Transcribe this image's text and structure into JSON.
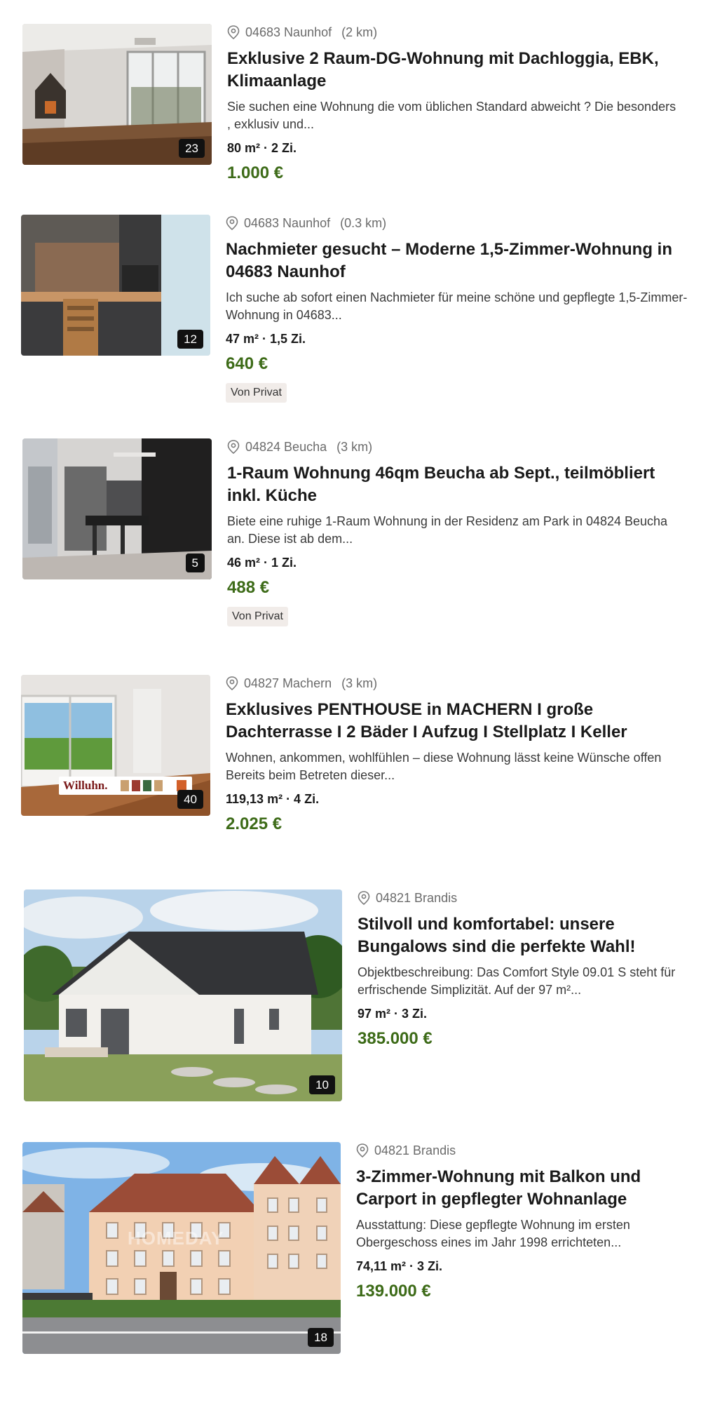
{
  "listings": [
    {
      "location": "04683 Naunhof",
      "distance": "(2 km)",
      "title": "Exklusive 2 Raum-DG-Wohnung mit Dachloggia, EBK, Klimaanlage",
      "description": "Sie suchen eine Wohnung die vom üblichen Standard abweicht ? Die besonders , exklusiv und...",
      "specs": "80 m² · 2 Zi.",
      "price": "1.000 €",
      "photo_count": "23",
      "tag": "",
      "image": "loft-interior-photo"
    },
    {
      "location": "04683 Naunhof",
      "distance": "(0.3 km)",
      "title": "Nachmieter gesucht – Moderne 1,5-Zimmer-Wohnung in 04683 Naunhof",
      "description": "Ich suche ab sofort einen Nachmieter für meine schöne und gepflegte 1,5-Zimmer-Wohnung in 04683...",
      "specs": "47 m² · 1,5 Zi.",
      "price": "640 €",
      "photo_count": "12",
      "tag": "Von Privat",
      "image": "kitchen-photo"
    },
    {
      "location": "04824 Beucha",
      "distance": "(3 km)",
      "title": "1-Raum Wohnung 46qm Beucha ab Sept., teilmöbliert inkl. Küche",
      "description": "Biete eine ruhige 1-Raum Wohnung in der Residenz am Park in 04824 Beucha an. Diese ist ab dem...",
      "specs": "46 m² · 1 Zi.",
      "price": "488 €",
      "photo_count": "5",
      "tag": "Von Privat",
      "image": "apartment-kitchen-photo"
    },
    {
      "location": "04827 Machern",
      "distance": "(3 km)",
      "title": "Exklusives PENTHOUSE in MACHERN I große Dachterrasse I 2 Bäder I Aufzug I Stellplatz I Keller",
      "description": "Wohnen, ankommen, wohlfühlen – diese Wohnung lässt keine Wünsche offen Bereits beim Betreten dieser...",
      "specs": "119,13 m² · 4 Zi.",
      "price": "2.025 €",
      "photo_count": "40",
      "tag": "",
      "image": "penthouse-interior-photo",
      "logo_text": "Willuhn."
    },
    {
      "location": "04821 Brandis",
      "distance": "",
      "title": "Stilvoll und komfortabel: unsere Bungalows sind die perfekte Wahl!",
      "description": "Objektbeschreibung: Das Comfort Style 09.01 S steht für erfrischende Simplizität. Auf der 97 m²...",
      "specs": "97 m² · 3 Zi.",
      "price": "385.000 €",
      "photo_count": "10",
      "tag": "",
      "image": "bungalow-exterior-photo"
    },
    {
      "location": "04821 Brandis",
      "distance": "",
      "title": "3-Zimmer-Wohnung mit Balkon und Carport in gepflegter Wohnanlage",
      "description": "Ausstattung: Diese gepflegte Wohnung im ersten Obergeschoss eines im Jahr 1998 errichteten...",
      "specs": "74,11 m² · 3 Zi.",
      "price": "139.000 €",
      "photo_count": "18",
      "tag": "",
      "image": "apartment-building-photo",
      "watermark_text": "HOMEDAY"
    }
  ],
  "colors": {
    "price": "#3d6b18",
    "location_text": "#6b6b6b",
    "tag_bg": "#f1ece9",
    "badge_bg": "#111111"
  }
}
